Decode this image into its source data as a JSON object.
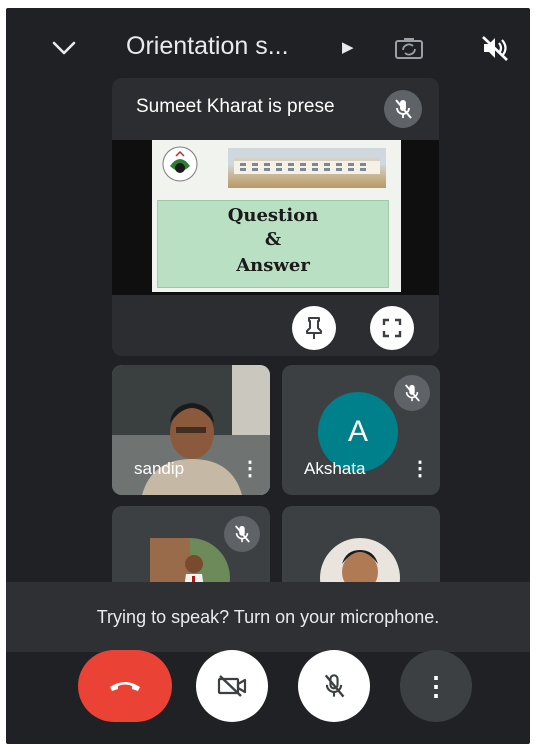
{
  "header": {
    "title": "Orientation s...",
    "title_arrow": "▶"
  },
  "presentation": {
    "label": "Sumeet Kharat is prese",
    "slide": {
      "line1": "Question",
      "line2": "&",
      "line3": "Answer"
    }
  },
  "participants": [
    {
      "name": "sandip",
      "more": "⋮"
    },
    {
      "name": "Akshata",
      "avatar_letter": "A",
      "more": "⋮"
    }
  ],
  "toast": {
    "message": "Trying to speak? Turn on your microphone."
  },
  "controls": {
    "more_label": "⋮"
  },
  "colors": {
    "background": "#202124",
    "end_call": "#ea4335",
    "avatar": "#00808a",
    "tile": "#3c4043"
  },
  "icons": [
    "chevron-down-icon",
    "camera-switch-icon",
    "speaker-off-icon",
    "mic-off-icon",
    "pin-icon",
    "fullscreen-icon",
    "end-call-icon",
    "camera-off-icon",
    "more-icon"
  ]
}
